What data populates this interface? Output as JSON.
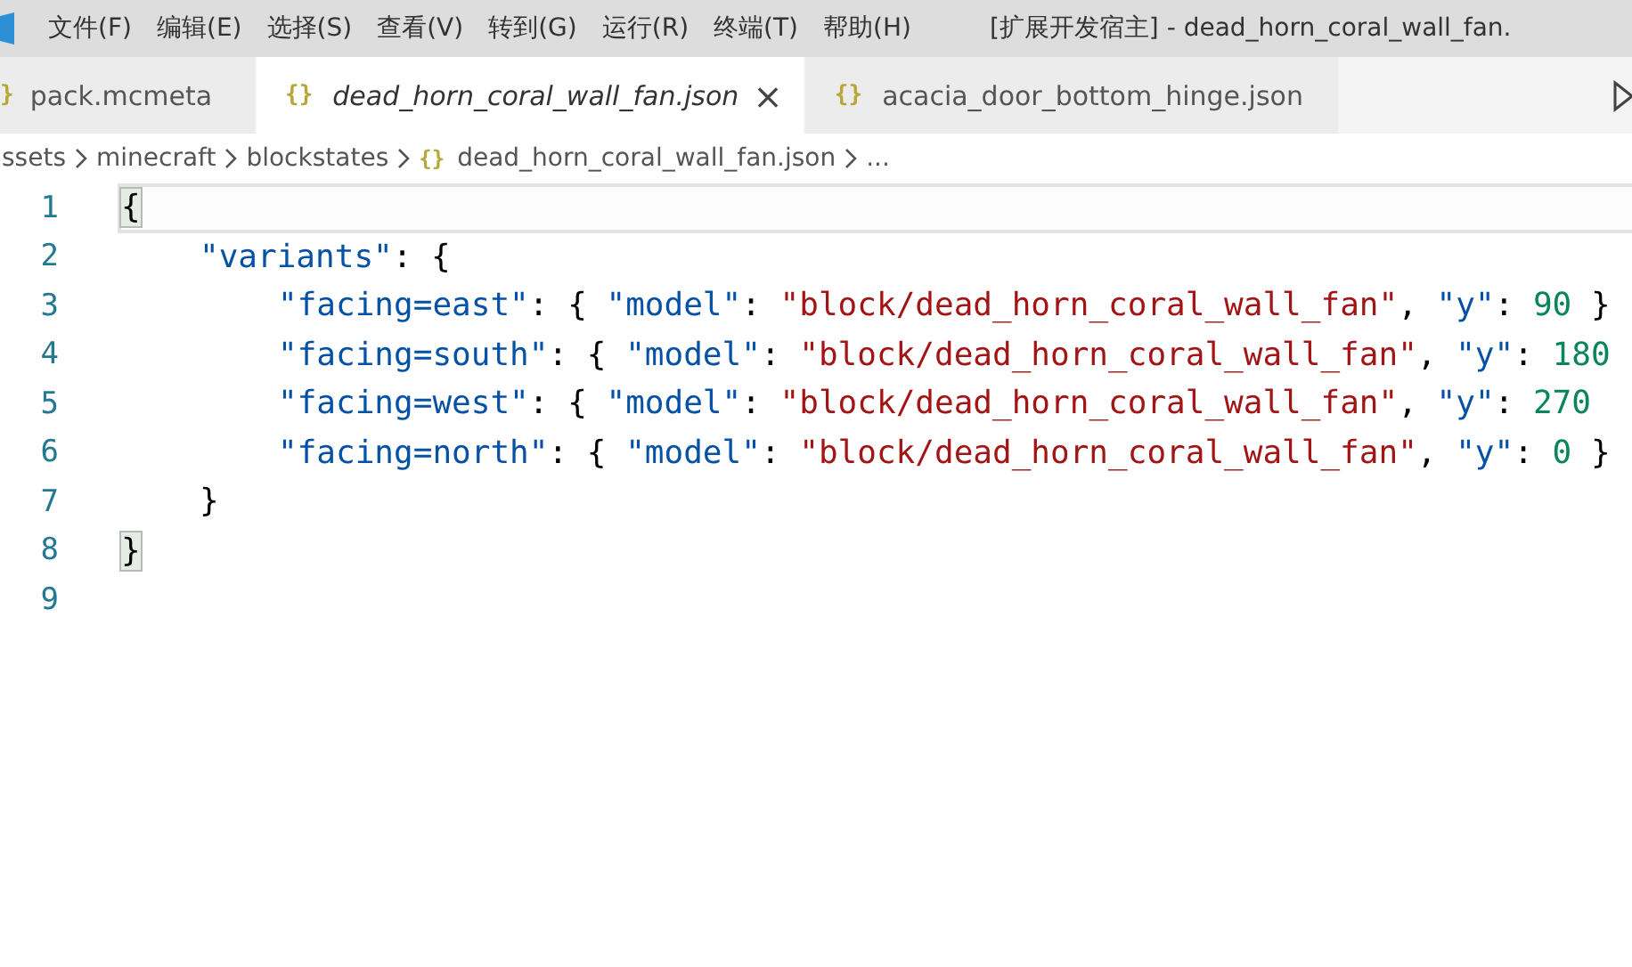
{
  "menu_bar": {
    "items": [
      "文件(F)",
      "编辑(E)",
      "选择(S)",
      "查看(V)",
      "转到(G)",
      "运行(R)",
      "终端(T)",
      "帮助(H)"
    ],
    "title": "[扩展开发宿主] - dead_horn_coral_wall_fan."
  },
  "tabs": [
    {
      "icon": "}",
      "label": "pack.mcmeta",
      "selected": false,
      "italic": false
    },
    {
      "icon": "{}",
      "label": "dead_horn_coral_wall_fan.json",
      "selected": true,
      "italic": true,
      "close": "×"
    },
    {
      "icon": "{}",
      "label": "acacia_door_bottom_hinge.json",
      "selected": false,
      "italic": false
    }
  ],
  "breadcrumbs": [
    {
      "label": "ssets"
    },
    {
      "label": "minecraft"
    },
    {
      "label": "blockstates"
    },
    {
      "label": "dead_horn_coral_wall_fan.json",
      "icon": "{}"
    },
    {
      "label": "..."
    }
  ],
  "editor": {
    "lines": [
      {
        "number": "1",
        "current": true,
        "tokens": [
          {
            "kind": "match",
            "text": "{"
          }
        ],
        "children": [
          {
            "number": "2",
            "current": false,
            "tokens": [
              {
                "kind": "key",
                "text": "\"variants\""
              },
              {
                "kind": "punct",
                "text": ": {"
              }
            ],
            "children": [
              {
                "number": "3",
                "current": false,
                "tokens": [
                  {
                    "kind": "key",
                    "text": "\"facing=east\""
                  },
                  {
                    "kind": "punct",
                    "text": ": { "
                  },
                  {
                    "kind": "key",
                    "text": "\"model\""
                  },
                  {
                    "kind": "punct",
                    "text": ": "
                  },
                  {
                    "kind": "string",
                    "text": "\"block/dead_horn_coral_wall_fan\""
                  },
                  {
                    "kind": "punct",
                    "text": ", "
                  },
                  {
                    "kind": "key",
                    "text": "\"y\""
                  },
                  {
                    "kind": "punct",
                    "text": ": "
                  },
                  {
                    "kind": "number",
                    "text": "90"
                  },
                  {
                    "kind": "punct",
                    "text": " }"
                  }
                ]
              },
              {
                "number": "4",
                "current": false,
                "tokens": [
                  {
                    "kind": "key",
                    "text": "\"facing=south\""
                  },
                  {
                    "kind": "punct",
                    "text": ": { "
                  },
                  {
                    "kind": "key",
                    "text": "\"model\""
                  },
                  {
                    "kind": "punct",
                    "text": ": "
                  },
                  {
                    "kind": "string",
                    "text": "\"block/dead_horn_coral_wall_fan\""
                  },
                  {
                    "kind": "punct",
                    "text": ", "
                  },
                  {
                    "kind": "key",
                    "text": "\"y\""
                  },
                  {
                    "kind": "punct",
                    "text": ": "
                  },
                  {
                    "kind": "number",
                    "text": "180"
                  }
                ]
              },
              {
                "number": "5",
                "current": false,
                "tokens": [
                  {
                    "kind": "key",
                    "text": "\"facing=west\""
                  },
                  {
                    "kind": "punct",
                    "text": ": { "
                  },
                  {
                    "kind": "key",
                    "text": "\"model\""
                  },
                  {
                    "kind": "punct",
                    "text": ": "
                  },
                  {
                    "kind": "string",
                    "text": "\"block/dead_horn_coral_wall_fan\""
                  },
                  {
                    "kind": "punct",
                    "text": ", "
                  },
                  {
                    "kind": "key",
                    "text": "\"y\""
                  },
                  {
                    "kind": "punct",
                    "text": ": "
                  },
                  {
                    "kind": "number",
                    "text": "270"
                  }
                ]
              },
              {
                "number": "6",
                "current": false,
                "tokens": [
                  {
                    "kind": "key",
                    "text": "\"facing=north\""
                  },
                  {
                    "kind": "punct",
                    "text": ": { "
                  },
                  {
                    "kind": "key",
                    "text": "\"model\""
                  },
                  {
                    "kind": "punct",
                    "text": ": "
                  },
                  {
                    "kind": "string",
                    "text": "\"block/dead_horn_coral_wall_fan\""
                  },
                  {
                    "kind": "punct",
                    "text": ", "
                  },
                  {
                    "kind": "key",
                    "text": "\"y\""
                  },
                  {
                    "kind": "punct",
                    "text": ": "
                  },
                  {
                    "kind": "number",
                    "text": "0"
                  },
                  {
                    "kind": "punct",
                    "text": " }"
                  }
                ]
              }
            ]
          },
          {
            "number": "7",
            "current": false,
            "tokens": [
              {
                "kind": "punct",
                "text": "}"
              }
            ]
          }
        ]
      },
      {
        "number": "8",
        "current": false,
        "tokens": [
          {
            "kind": "match",
            "text": "}"
          }
        ]
      },
      {
        "number": "9",
        "current": false
      }
    ]
  }
}
